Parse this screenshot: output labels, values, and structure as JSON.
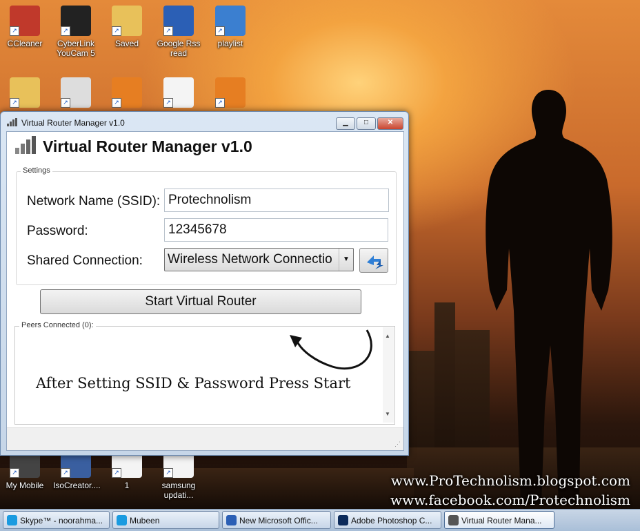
{
  "desktop": {
    "icons_top": [
      {
        "label": "CCleaner",
        "icon": "ccleaner-icon",
        "color": "#c0392b"
      },
      {
        "label": "CyberLink\nYouCam 5",
        "icon": "webcam-icon",
        "color": "#222222"
      },
      {
        "label": "Saved",
        "icon": "folder-icon",
        "color": "#e8c15a"
      },
      {
        "label": "Google Rss\nread",
        "icon": "word-document-icon",
        "color": "#2b5fb5"
      },
      {
        "label": "playlist",
        "icon": "audio-file-icon",
        "color": "#3b7fd0"
      }
    ],
    "icons_row2": [
      {
        "label": "",
        "icon": "downloads-folder-icon",
        "color": "#e8c15a"
      },
      {
        "label": "",
        "icon": "wifi-hotspot-icon",
        "color": "#dddddd"
      },
      {
        "label": "",
        "icon": "fish-app-icon",
        "color": "#e67e22"
      },
      {
        "label": "",
        "icon": "text-document-icon",
        "color": "#f4f4f4"
      },
      {
        "label": "",
        "icon": "kingsoft-icon",
        "color": "#e67e22"
      }
    ],
    "icons_bottom": [
      {
        "label": "My Mobile",
        "icon": "mobile-icon",
        "color": "#444444"
      },
      {
        "label": "IsoCreator....",
        "icon": "iso-creator-icon",
        "color": "#3a5fa0"
      },
      {
        "label": "1",
        "icon": "document-icon",
        "color": "#f4f4f4"
      },
      {
        "label": "samsung\nupdati...",
        "icon": "document-icon",
        "color": "#f4f4f4"
      }
    ],
    "watermark_line1": "www.ProTechnolism.blogspot.com",
    "watermark_line2": "www.facebook.com/Protechnolism"
  },
  "window": {
    "title": "Virtual Router Manager v1.0",
    "app_heading": "Virtual Router Manager v1.0",
    "settings_group": "Settings",
    "ssid_label": "Network Name (SSID):",
    "ssid_value": "Protechnolism",
    "password_label": "Password:",
    "password_value": "12345678",
    "shared_label": "Shared Connection:",
    "shared_value": "Wireless Network Connectio",
    "start_button": "Start Virtual Router",
    "peers_group": "Peers Connected (0):",
    "annotation": "After Setting SSID & Password Press Start",
    "minimize": "▁",
    "maximize": "□",
    "close": "✕"
  },
  "taskbar": [
    {
      "label": "Skype™ - noorahma...",
      "icon_color": "#1a9be0"
    },
    {
      "label": "Mubeen",
      "icon_color": "#1a9be0"
    },
    {
      "label": "New Microsoft Offic...",
      "icon_color": "#2b5fb5"
    },
    {
      "label": "Adobe Photoshop C...",
      "icon_color": "#0b2a5a"
    },
    {
      "label": "Virtual Router Mana...",
      "icon_color": "#555555",
      "active": true
    }
  ]
}
